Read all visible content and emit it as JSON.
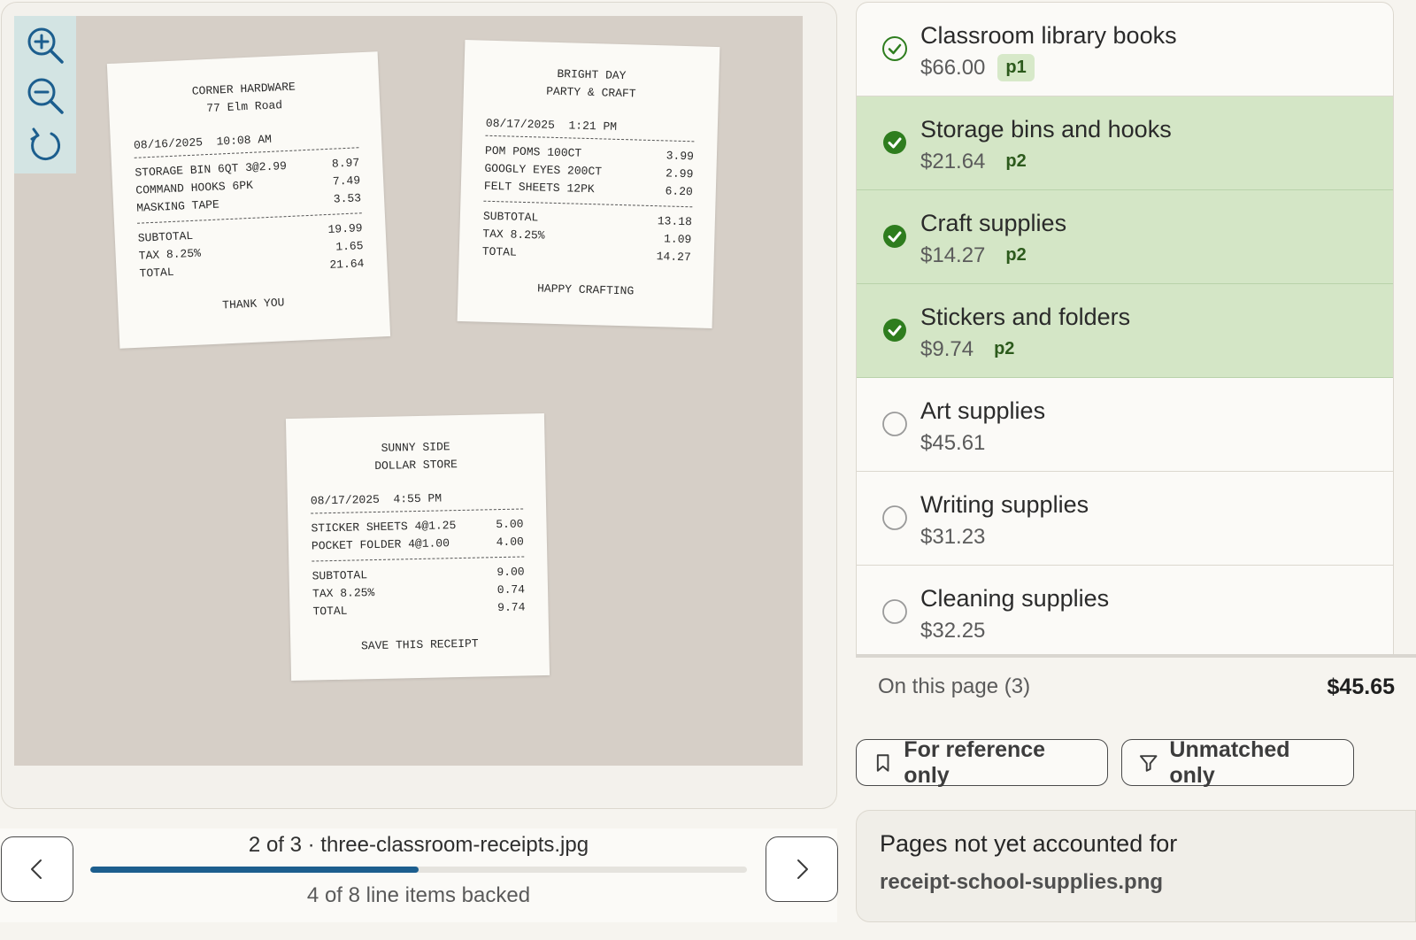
{
  "viewer": {
    "tools": [
      {
        "name": "zoom-in-icon"
      },
      {
        "name": "zoom-out-icon"
      },
      {
        "name": "rotate-icon"
      }
    ],
    "receipts": [
      {
        "header": [
          "CORNER HARDWARE",
          "77 Elm Road"
        ],
        "meta": "08/16/2025  10:08 AM",
        "items": [
          {
            "desc": "STORAGE BIN 6QT 3@2.99",
            "amt": "8.97"
          },
          {
            "desc": "COMMAND HOOKS 6PK",
            "amt": "7.49"
          },
          {
            "desc": "MASKING TAPE",
            "amt": "3.53"
          }
        ],
        "totals": [
          {
            "desc": "SUBTOTAL",
            "amt": "19.99"
          },
          {
            "desc": "TAX 8.25%",
            "amt": "1.65"
          },
          {
            "desc": "TOTAL",
            "amt": "21.64"
          }
        ],
        "footer": "THANK YOU"
      },
      {
        "header": [
          "BRIGHT DAY",
          "PARTY & CRAFT"
        ],
        "meta": "08/17/2025  1:21 PM",
        "items": [
          {
            "desc": "POM POMS 100CT",
            "amt": "3.99"
          },
          {
            "desc": "GOOGLY EYES 200CT",
            "amt": "2.99"
          },
          {
            "desc": "FELT SHEETS 12PK",
            "amt": "6.20"
          }
        ],
        "totals": [
          {
            "desc": "SUBTOTAL",
            "amt": "13.18"
          },
          {
            "desc": "TAX 8.25%",
            "amt": "1.09"
          },
          {
            "desc": "TOTAL",
            "amt": "14.27"
          }
        ],
        "footer": "HAPPY CRAFTING"
      },
      {
        "header": [
          "SUNNY SIDE",
          "DOLLAR STORE"
        ],
        "meta": "08/17/2025  4:55 PM",
        "items": [
          {
            "desc": "STICKER SHEETS 4@1.25",
            "amt": "5.00"
          },
          {
            "desc": "POCKET FOLDER 4@1.00",
            "amt": "4.00"
          }
        ],
        "totals": [
          {
            "desc": "SUBTOTAL",
            "amt": "9.00"
          },
          {
            "desc": "TAX 8.25%",
            "amt": "0.74"
          },
          {
            "desc": "TOTAL",
            "amt": "9.74"
          }
        ],
        "footer": "SAVE THIS RECEIPT"
      }
    ]
  },
  "pager": {
    "title": "2 of 3 · three-classroom-receipts.jpg",
    "subtitle": "4 of 8 line items backed",
    "progress_fraction": 0.5,
    "progress_color": "#1c5e8e"
  },
  "line_items": [
    {
      "name": "Classroom library books",
      "price": "$66.00",
      "page": "p1",
      "state": "matched-other"
    },
    {
      "name": "Storage bins and hooks",
      "price": "$21.64",
      "page": "p2",
      "state": "selected"
    },
    {
      "name": "Craft supplies",
      "price": "$14.27",
      "page": "p2",
      "state": "selected"
    },
    {
      "name": "Stickers and folders",
      "price": "$9.74",
      "page": "p2",
      "state": "selected"
    },
    {
      "name": "Art supplies",
      "price": "$45.61",
      "page": "",
      "state": "unmatched"
    },
    {
      "name": "Writing supplies",
      "price": "$31.23",
      "page": "",
      "state": "unmatched"
    },
    {
      "name": "Cleaning supplies",
      "price": "$32.25",
      "page": "",
      "state": "unmatched"
    }
  ],
  "summary": {
    "label": "On this page (3)",
    "total": "$45.65"
  },
  "filters": {
    "reference_label": "For reference only",
    "unmatched_label": "Unmatched only"
  },
  "pending": {
    "title": "Pages not yet accounted for",
    "file": "receipt-school-supplies.png"
  },
  "colors": {
    "selected_bg": "#d4e6c6",
    "check_green": "#2e7d1e",
    "accent_blue": "#1c5e8e"
  }
}
